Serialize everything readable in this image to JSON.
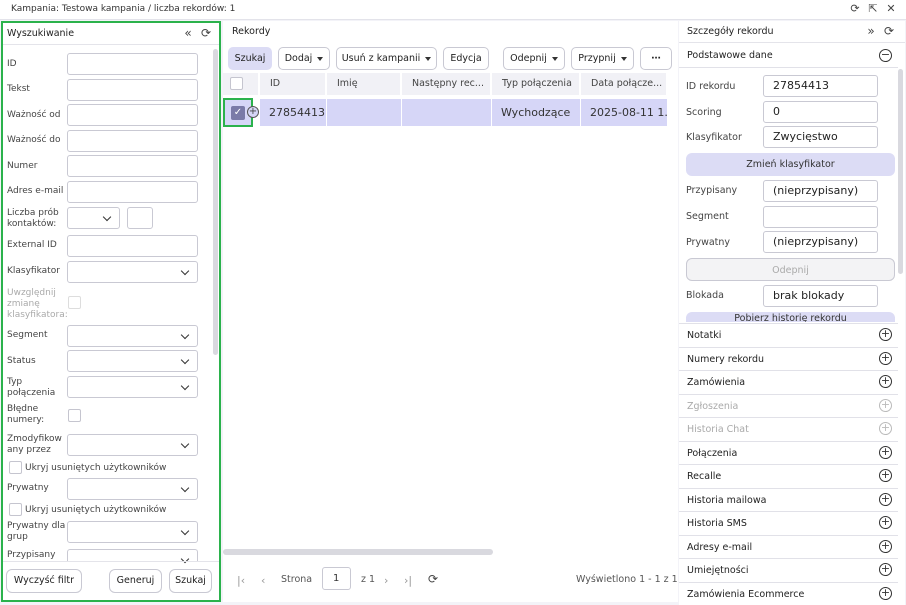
{
  "window": {
    "title": "Kampania: Testowa kampania / liczba rekordów: 1"
  },
  "left": {
    "title": "Wyszukiwanie",
    "fields": {
      "id": "ID",
      "tekst": "Tekst",
      "waznosc_od": "Ważność od",
      "waznosc_do": "Ważność do",
      "numer": "Numer",
      "email": "Adres e-mail",
      "liczba_prob": "Liczba prób kontaktów:",
      "external_id": "External ID",
      "klasyfikator": "Klasyfikator",
      "uwzglednij": "Uwzględnij zmianę klasyfikatora:",
      "segment": "Segment",
      "status": "Status",
      "typ_polaczenia": "Typ połączenia",
      "bledne_numery": "Błędne numery:",
      "zmodyfikowany": "Zmodyfikow any przez",
      "ukryj1": "Ukryj usuniętych użytkowników",
      "prywatny": "Prywatny",
      "ukryj2": "Ukryj usuniętych użytkowników",
      "prywatny_grup": "Prywatny dla grup",
      "przypisany": "Przypisany"
    },
    "buttons": {
      "clear": "Wyczyść filtr",
      "generate": "Generuj",
      "search": "Szukaj"
    }
  },
  "center": {
    "title": "Rekordy",
    "toolbar": {
      "szukaj": "Szukaj",
      "dodaj": "Dodaj",
      "usun": "Usuń z kampanii",
      "edycja": "Edycja",
      "odepnij": "Odepnij",
      "przypnij": "Przypnij",
      "more": "⋯"
    },
    "columns": [
      "ID",
      "Imię",
      "Następny rec...",
      "Typ połączenia",
      "Data połącze..."
    ],
    "rows": [
      {
        "id": "27854413",
        "imie": "",
        "nastepny": "",
        "typ": "Wychodzące",
        "data": "2025-08-11 1..."
      }
    ],
    "pager": {
      "strona": "Strona",
      "page": "1",
      "of": "z 1",
      "info": "Wyświetlono 1 - 1 z 1"
    }
  },
  "right": {
    "title": "Szczegóły rekordu",
    "section": "Podstawowe dane",
    "fields": {
      "id_label": "ID rekordu",
      "id_value": "27854413",
      "scoring_label": "Scoring",
      "scoring_value": "0",
      "klas_label": "Klasyfikator",
      "klas_value": "Zwycięstwo",
      "zmien": "Zmień klasyfikator",
      "przyp_label": "Przypisany",
      "przyp_value": "(nieprzypisany)",
      "segment_label": "Segment",
      "segment_value": "",
      "pryw_label": "Prywatny",
      "pryw_value": "(nieprzypisany)",
      "odepnij": "Odepnij",
      "blokada_label": "Blokada",
      "blokada_value": "brak blokady",
      "pobierz": "Pobierz historię rekordu"
    },
    "sections": [
      {
        "label": "Notatki",
        "disabled": false
      },
      {
        "label": "Numery rekordu",
        "disabled": false
      },
      {
        "label": "Zamówienia",
        "disabled": false
      },
      {
        "label": "Zgłoszenia",
        "disabled": true
      },
      {
        "label": "Historia Chat",
        "disabled": true
      },
      {
        "label": "Połączenia",
        "disabled": false
      },
      {
        "label": "Recalle",
        "disabled": false
      },
      {
        "label": "Historia mailowa",
        "disabled": false
      },
      {
        "label": "Historia SMS",
        "disabled": false
      },
      {
        "label": "Adresy e-mail",
        "disabled": false
      },
      {
        "label": "Umiejętności",
        "disabled": false
      },
      {
        "label": "Zamówienia Ecommerce",
        "disabled": false
      }
    ]
  },
  "colors": {
    "accent": "#dcdcf5",
    "row_selected": "#d6d6f7",
    "highlight": "#2bb24c"
  }
}
